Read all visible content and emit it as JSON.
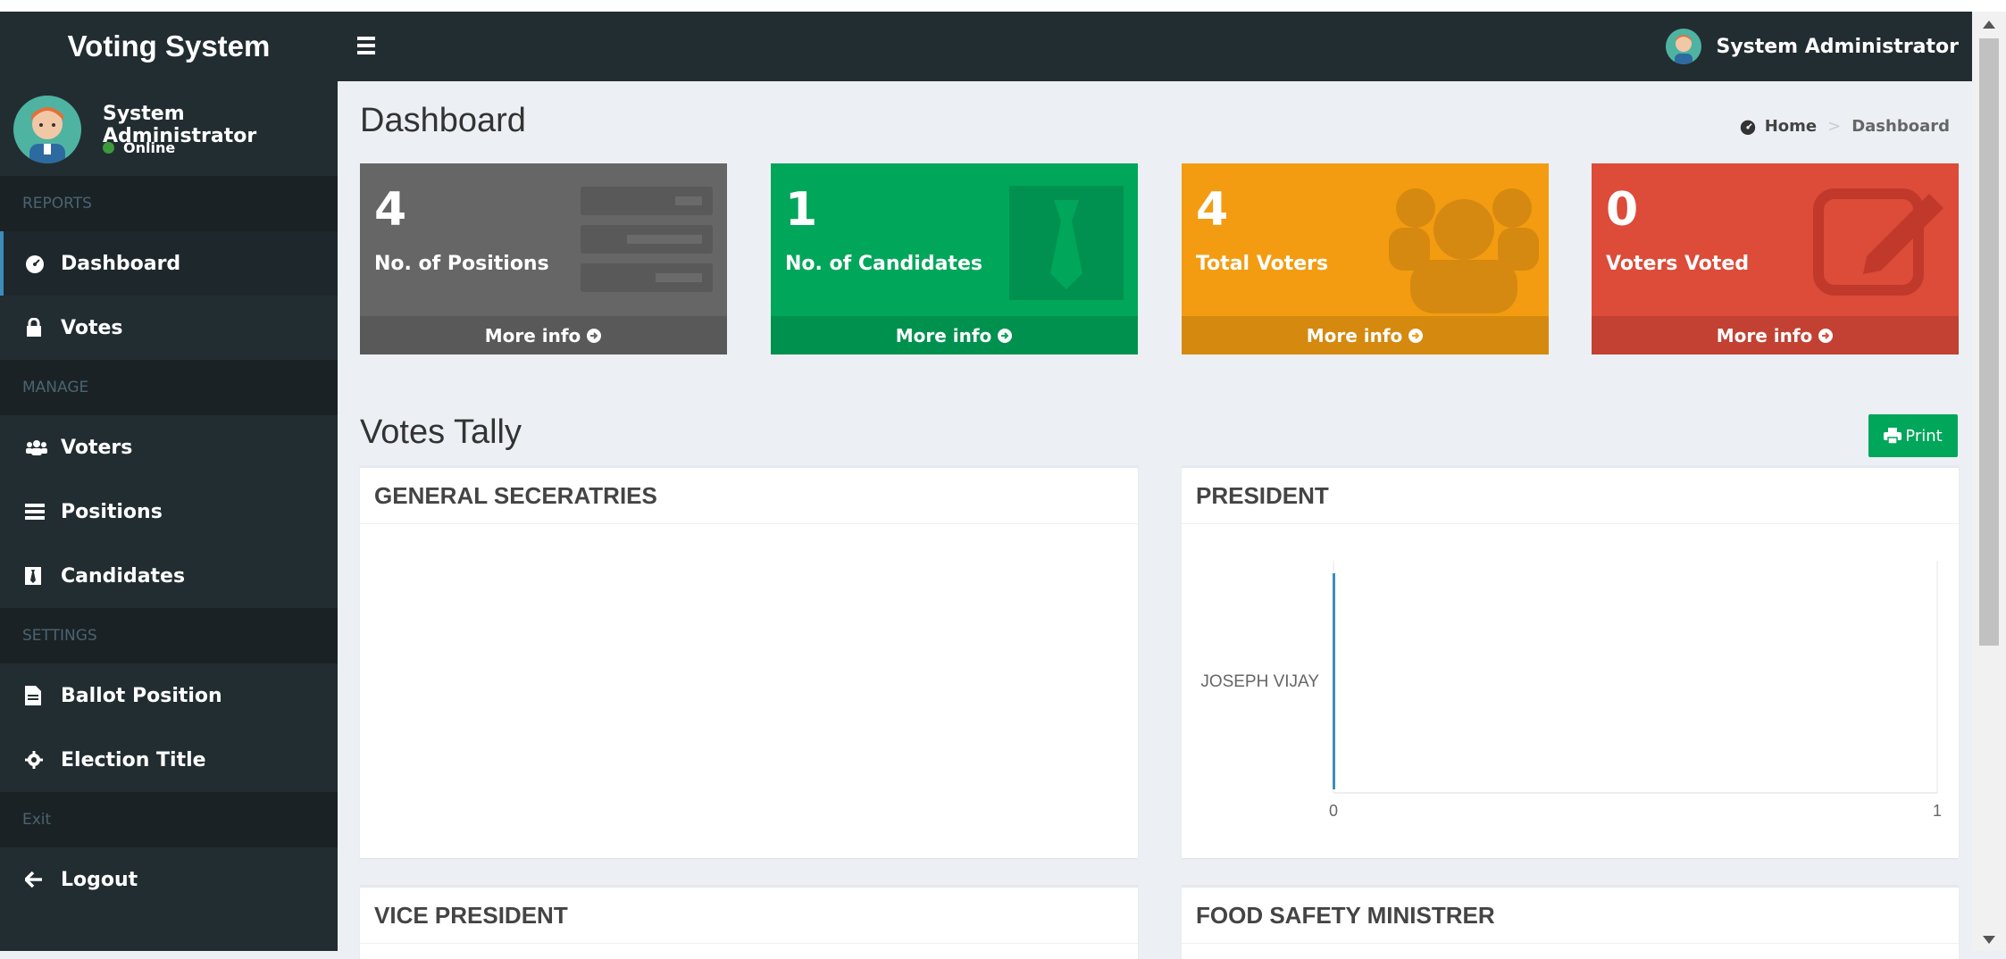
{
  "app": {
    "title": "Voting System"
  },
  "header": {
    "user_name": "System Administrator"
  },
  "sidebar": {
    "user_name": "System Administrator",
    "status": "Online",
    "sections": {
      "reports": "REPORTS",
      "manage": "MANAGE",
      "settings": "SETTINGS",
      "exit": "Exit"
    },
    "items": {
      "dashboard": "Dashboard",
      "votes": "Votes",
      "voters": "Voters",
      "positions": "Positions",
      "candidates": "Candidates",
      "ballot_position": "Ballot Position",
      "election_title": "Election Title",
      "logout": "Logout"
    }
  },
  "page": {
    "title": "Dashboard",
    "breadcrumb": {
      "home": "Home",
      "current": "Dashboard"
    }
  },
  "stats": [
    {
      "value": "4",
      "label": "No. of Positions",
      "more": "More info",
      "color": "#666666"
    },
    {
      "value": "1",
      "label": "No. of Candidates",
      "more": "More info",
      "color": "#00a65a"
    },
    {
      "value": "4",
      "label": "Total Voters",
      "more": "More info",
      "color": "#f39c12"
    },
    {
      "value": "0",
      "label": "Voters Voted",
      "more": "More info",
      "color": "#dd4b39"
    }
  ],
  "tally": {
    "title": "Votes Tally",
    "print_label": "Print",
    "panels": [
      {
        "title": "GENERAL SECERATRIES"
      },
      {
        "title": "PRESIDENT"
      },
      {
        "title": "VICE PRESIDENT"
      },
      {
        "title": "FOOD SAFETY MINISTRER"
      }
    ]
  },
  "chart_data": {
    "type": "bar",
    "orientation": "horizontal",
    "categories": [
      "JOSEPH VIJAY"
    ],
    "values": [
      0
    ],
    "xlim": [
      0,
      1
    ],
    "x_ticks": [
      "0",
      "1"
    ],
    "series_color": "#3c8dbc"
  }
}
